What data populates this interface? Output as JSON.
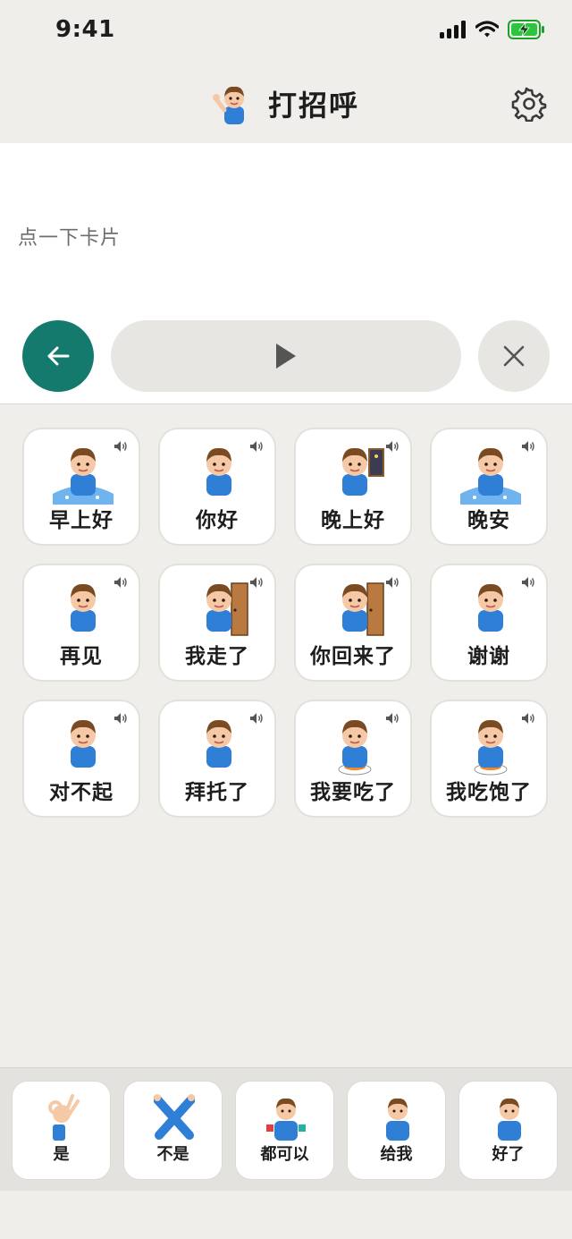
{
  "status": {
    "time": "9:41"
  },
  "header": {
    "title": "打招呼",
    "icon": "boy-waving-icon",
    "settings_icon": "gear-icon"
  },
  "message": {
    "placeholder": "点一下卡片"
  },
  "controls": {
    "back_icon": "arrow-left-icon",
    "play_icon": "play-icon",
    "clear_icon": "close-icon"
  },
  "colors": {
    "accent": "#157a6e",
    "boy_shirt": "#2f7fd6",
    "hair": "#7a4a22",
    "skin": "#f6c9a6"
  },
  "cards": [
    {
      "label": "早上好",
      "icon": "boy-waking-up-icon"
    },
    {
      "label": "你好",
      "icon": "boy-waving-icon"
    },
    {
      "label": "晚上好",
      "icon": "boy-evening-window-icon"
    },
    {
      "label": "晚安",
      "icon": "boy-sleeping-icon"
    },
    {
      "label": "再见",
      "icon": "boy-leaving-icon"
    },
    {
      "label": "我走了",
      "icon": "boy-door-leaving-icon"
    },
    {
      "label": "你回来了",
      "icon": "boy-door-welcome-icon"
    },
    {
      "label": "谢谢",
      "icon": "boy-thanks-icon"
    },
    {
      "label": "对不起",
      "icon": "boy-bowing-icon"
    },
    {
      "label": "拜托了",
      "icon": "boy-pleading-icon"
    },
    {
      "label": "我要吃了",
      "icon": "boy-eating-icon"
    },
    {
      "label": "我吃饱了",
      "icon": "boy-full-icon"
    }
  ],
  "quick_replies": [
    {
      "label": "是",
      "icon": "ok-hand-icon"
    },
    {
      "label": "不是",
      "icon": "crossed-arms-icon"
    },
    {
      "label": "都可以",
      "icon": "boy-two-choices-icon"
    },
    {
      "label": "给我",
      "icon": "boy-give-me-icon"
    },
    {
      "label": "好了",
      "icon": "boy-done-icon"
    }
  ]
}
